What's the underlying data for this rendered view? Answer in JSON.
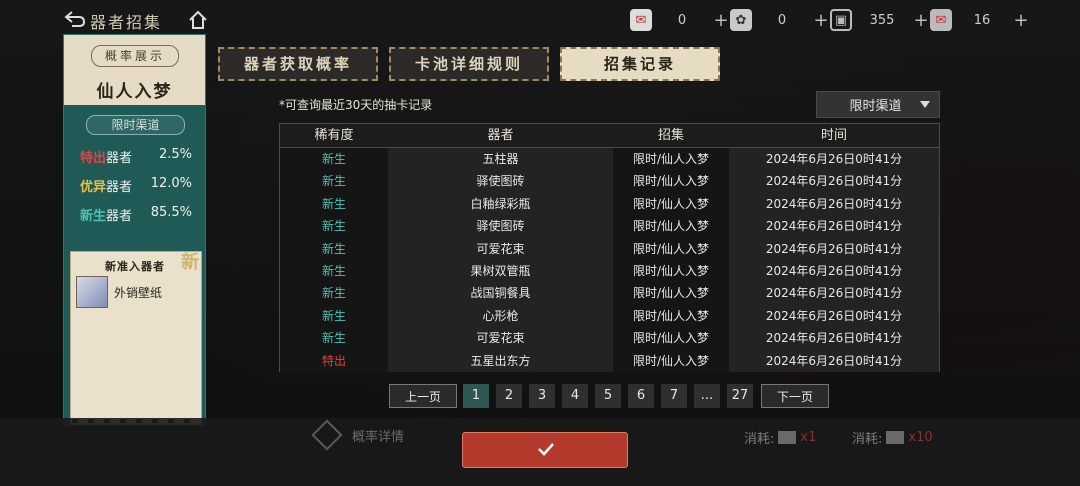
{
  "header": {
    "title": "器者招集",
    "resources": [
      {
        "icon": "ticket-icon",
        "value": "0"
      },
      {
        "icon": "coin-icon",
        "value": "0"
      },
      {
        "icon": "scroll-icon",
        "value": "355"
      },
      {
        "icon": "pass-icon",
        "value": "16"
      }
    ]
  },
  "sidebar": {
    "badge": "概率展示",
    "pool_name": "仙人入梦",
    "channel": "限时渠道",
    "rates": [
      {
        "tier": "特出",
        "suffix": "器者",
        "value": "2.5%",
        "color": "#e54242"
      },
      {
        "tier": "优异",
        "suffix": "器者",
        "value": "12.0%",
        "color": "#e6c04a"
      },
      {
        "tier": "新生",
        "suffix": "器者",
        "value": "85.5%",
        "color": "#4fc1b4"
      }
    ],
    "new_title": "新准入器者",
    "new_tag": "新",
    "new_item": "外销壁纸"
  },
  "tabs": [
    "器者获取概率",
    "卡池详细规则",
    "招集记录"
  ],
  "note": "*可查询最近30天的抽卡记录",
  "filter": {
    "selected": "限时渠道"
  },
  "table": {
    "headers": [
      "稀有度",
      "器者",
      "招集",
      "时间"
    ],
    "rows": [
      {
        "rarity": "新生",
        "item": "五柱器",
        "pool": "限时/仙人入梦",
        "time": "2024年6月26日0时41分"
      },
      {
        "rarity": "新生",
        "item": "驿使图砖",
        "pool": "限时/仙人入梦",
        "time": "2024年6月26日0时41分"
      },
      {
        "rarity": "新生",
        "item": "白釉绿彩瓶",
        "pool": "限时/仙人入梦",
        "time": "2024年6月26日0时41分"
      },
      {
        "rarity": "新生",
        "item": "驿使图砖",
        "pool": "限时/仙人入梦",
        "time": "2024年6月26日0时41分"
      },
      {
        "rarity": "新生",
        "item": "可爱花束",
        "pool": "限时/仙人入梦",
        "time": "2024年6月26日0时41分"
      },
      {
        "rarity": "新生",
        "item": "果树双管瓶",
        "pool": "限时/仙人入梦",
        "time": "2024年6月26日0时41分"
      },
      {
        "rarity": "新生",
        "item": "战国铜餐具",
        "pool": "限时/仙人入梦",
        "time": "2024年6月26日0时41分"
      },
      {
        "rarity": "新生",
        "item": "心形枪",
        "pool": "限时/仙人入梦",
        "time": "2024年6月26日0时41分"
      },
      {
        "rarity": "新生",
        "item": "可爱花束",
        "pool": "限时/仙人入梦",
        "time": "2024年6月26日0时41分"
      },
      {
        "rarity": "特出",
        "item": "五星出东方",
        "pool": "限时/仙人入梦",
        "time": "2024年6月26日0时41分"
      }
    ]
  },
  "pagination": {
    "prev": "上一页",
    "next": "下一页",
    "pages": [
      "1",
      "2",
      "3",
      "4",
      "5",
      "6",
      "7",
      "...",
      "27"
    ],
    "current": "1"
  },
  "footer": {
    "prob_detail": "概率详情",
    "cost_label": "消耗:",
    "cost_single": "x1",
    "cost_ten": "x10"
  }
}
